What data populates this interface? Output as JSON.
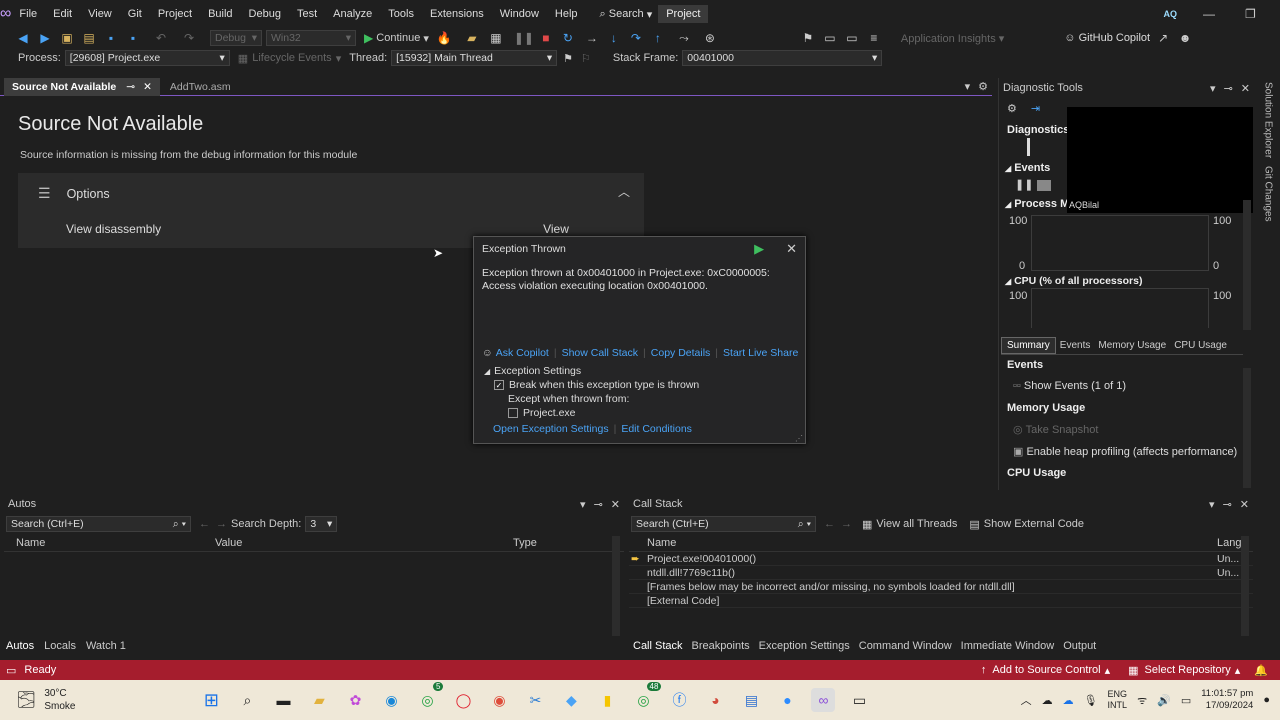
{
  "menubar": {
    "items": [
      "File",
      "Edit",
      "View",
      "Git",
      "Project",
      "Build",
      "Debug",
      "Test",
      "Analyze",
      "Tools",
      "Extensions",
      "Window",
      "Help"
    ],
    "search": "Search",
    "project": "Project",
    "user_initials": "AQ"
  },
  "toolbar": {
    "config": "Debug",
    "platform": "Win32",
    "continue": "Continue",
    "app_insights": "Application Insights",
    "copilot": "GitHub Copilot"
  },
  "debugbar": {
    "process_label": "Process:",
    "process_value": "[29608] Project.exe",
    "lifecycle": "Lifecycle Events",
    "thread_label": "Thread:",
    "thread_value": "[15932] Main Thread",
    "frame_label": "Stack Frame:",
    "frame_value": "00401000"
  },
  "tabs": {
    "active": "Source Not Available",
    "other": "AddTwo.asm"
  },
  "doc": {
    "title": "Source Not Available",
    "subtitle": "Source information is missing from the debug information for this module",
    "options": "Options",
    "view_disassembly": "View disassembly",
    "view_btn": "View"
  },
  "exception": {
    "title": "Exception Thrown",
    "message": "Exception thrown at 0x00401000 in Project.exe: 0xC0000005: Access violation executing location 0x00401000.",
    "links": [
      "Ask Copilot",
      "Show Call Stack",
      "Copy Details",
      "Start Live Share ses"
    ],
    "settings_header": "Exception Settings",
    "break_when": "Break when this exception type is thrown",
    "except_when": "Except when thrown from:",
    "module": "Project.exe",
    "open_settings": "Open Exception Settings",
    "edit_conditions": "Edit Conditions"
  },
  "diag": {
    "title": "Diagnostic Tools",
    "session": "Diagnostics s",
    "events": "Events",
    "process_mem": "Process Mer",
    "overlay_user": "AQBilal",
    "mem_max": "100",
    "mem_min": "0",
    "cpu": "CPU (% of all processors)",
    "cpu_max": "100",
    "tabs": [
      "Summary",
      "Events",
      "Memory Usage",
      "CPU Usage"
    ],
    "sec_events": "Events",
    "show_events": "Show Events (1 of 1)",
    "sec_memory": "Memory Usage",
    "take_snapshot": "Take Snapshot",
    "heap": "Enable heap profiling (affects performance)",
    "sec_cpu": "CPU Usage"
  },
  "right_rail": [
    "Solution Explorer",
    "Git Changes"
  ],
  "autos": {
    "title": "Autos",
    "search": "Search (Ctrl+E)",
    "depth_label": "Search Depth:",
    "depth": "3",
    "cols": [
      "Name",
      "Value",
      "Type"
    ],
    "tabs": [
      "Autos",
      "Locals",
      "Watch 1"
    ]
  },
  "callstack": {
    "title": "Call Stack",
    "search": "Search (Ctrl+E)",
    "view_threads": "View all Threads",
    "show_external": "Show External Code",
    "cols": [
      "Name",
      "Lang"
    ],
    "rows": [
      {
        "name": "Project.exe!00401000()",
        "lang": "Un..."
      },
      {
        "name": "ntdll.dll!7769c11b()",
        "lang": "Un..."
      },
      {
        "name": "[Frames below may be incorrect and/or missing, no symbols loaded for ntdll.dll]",
        "lang": ""
      },
      {
        "name": "[External Code]",
        "lang": ""
      }
    ],
    "tabs": [
      "Call Stack",
      "Breakpoints",
      "Exception Settings",
      "Command Window",
      "Immediate Window",
      "Output"
    ]
  },
  "status": {
    "ready": "Ready",
    "source_control": "Add to Source Control",
    "repo": "Select Repository"
  },
  "taskbar": {
    "temp": "30°C",
    "weather": "Smoke",
    "lang1": "ENG",
    "lang2": "INTL",
    "time": "11:01:57 pm",
    "date": "17/09/2024",
    "badge_whatsapp": "5",
    "badge_msgs": "48"
  }
}
